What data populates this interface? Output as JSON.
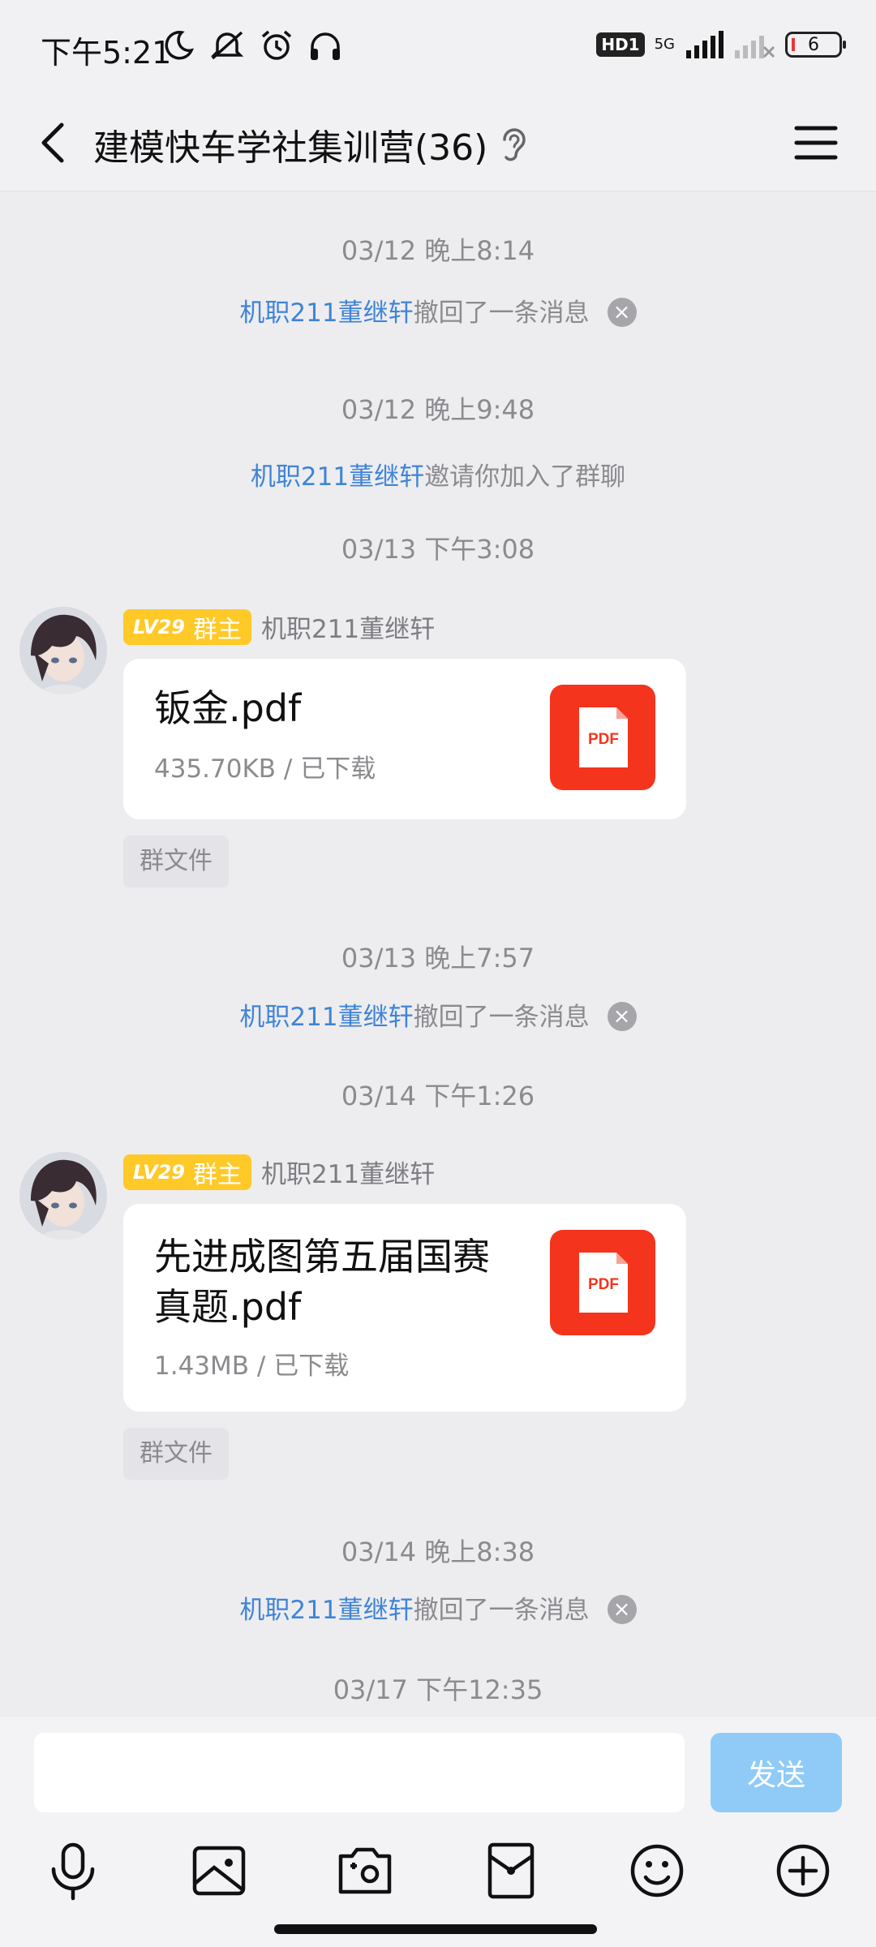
{
  "status_bar": {
    "time": "下午5:21",
    "hd": "HD1",
    "network": "5G",
    "battery": "6"
  },
  "header": {
    "title": "建模快车学社集训营(36)"
  },
  "messages": {
    "ts1": "03/12 晚上8:14",
    "sys1_who": "机职211董继轩",
    "sys1_text": "撤回了一条消息",
    "ts2": "03/12 晚上9:48",
    "sys2_who": "机职211董继轩",
    "sys2_text": "邀请你加入了群聊",
    "ts3": "03/13 下午3:08",
    "msg1": {
      "level": "LV29",
      "role": "群主",
      "sender": "机职211董继轩",
      "file_name": "钣金.pdf",
      "file_meta": "435.70KB / 已下载",
      "file_type": "PDF",
      "tag": "群文件"
    },
    "ts4": "03/13 晚上7:57",
    "sys3_who": "机职211董继轩",
    "sys3_text": "撤回了一条消息",
    "ts5": "03/14 下午1:26",
    "msg2": {
      "level": "LV29",
      "role": "群主",
      "sender": "机职211董继轩",
      "file_name_line1": "先进成图第五届国赛",
      "file_name_line2": "真题.pdf",
      "file_meta": "1.43MB / 已下载",
      "file_type": "PDF",
      "tag": "群文件"
    },
    "ts6": "03/14 晚上8:38",
    "sys4_who": "机职211董继轩",
    "sys4_text": "撤回了一条消息",
    "ts7": "03/17 下午12:35"
  },
  "input_bar": {
    "value": "",
    "send_label": "发送"
  },
  "toolbar": [
    "mic-icon",
    "image-icon",
    "camera-icon",
    "red-packet-icon",
    "emoji-icon",
    "plus-icon"
  ],
  "colors": {
    "link_blue": "#3f84d7",
    "badge_yellow": "#ffc928",
    "pdf_red": "#f5341d",
    "send_disabled": "#90cbf8"
  }
}
